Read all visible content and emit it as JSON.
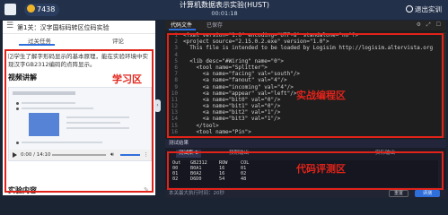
{
  "topbar": {
    "coin_count": "7438",
    "title": "计算机数据表示实验(HUST)",
    "timer": "00:01:18",
    "exit_label": "退出实训"
  },
  "left": {
    "level_title": "第1关：汉字国标码转区位码实验",
    "tabs": [
      "过关任务",
      "评论"
    ],
    "description": "⑵学生了解字形码显示的基本原理，能在实验环境中实现汉字GB2312编码的点阵显示。",
    "section_video": "视频讲解",
    "video_time": "0:00 / 14:10",
    "section_content": "实验内容",
    "label": "学习区"
  },
  "editor": {
    "tabs": [
      "代码文件",
      "已保存"
    ],
    "label": "实战编程区",
    "lines": [
      {
        "n": "1",
        "t": "<?xml version=\"1.0\" encoding=\"UTF-8\" standalone=\"no\"?>"
      },
      {
        "n": "2",
        "t": "<project source=\"2.15.0.2.exe\" version=\"1.0\">"
      },
      {
        "n": "3",
        "t": "  This file is intended to be loaded by Logisim http://logisim.altervista.org"
      },
      {
        "n": "4",
        "t": ""
      },
      {
        "n": "5",
        "t": "  <lib desc=\"#Wiring\" name=\"0\">"
      },
      {
        "n": "6",
        "t": "    <tool name=\"Splitter\">"
      },
      {
        "n": "7",
        "t": "      <a name=\"facing\" val=\"south\"/>"
      },
      {
        "n": "8",
        "t": "      <a name=\"fanout\" val=\"4\"/>"
      },
      {
        "n": "9",
        "t": "      <a name=\"incoming\" val=\"4\"/>"
      },
      {
        "n": "10",
        "t": "      <a name=\"appear\" val=\"left\"/>"
      },
      {
        "n": "11",
        "t": "      <a name=\"bit0\" val=\"0\"/>"
      },
      {
        "n": "12",
        "t": "      <a name=\"bit1\" val=\"0\"/>"
      },
      {
        "n": "13",
        "t": "      <a name=\"bit2\" val=\"1\"/>"
      },
      {
        "n": "14",
        "t": "      <a name=\"bit3\" val=\"1\"/>"
      },
      {
        "n": "15",
        "t": "    </tool>"
      },
      {
        "n": "16",
        "t": "    <tool name=\"Pin\">"
      }
    ]
  },
  "console": {
    "header": "测试结果",
    "tabs": [
      "测试集 1",
      "预期输出",
      "实际输出"
    ],
    "label": "代码评测区",
    "table_headers": [
      "Out",
      "GB2312",
      "ROW",
      "COL"
    ],
    "rows": [
      [
        "00",
        "B0A1",
        "16",
        "01"
      ],
      [
        "01",
        "B0A2",
        "16",
        "02"
      ],
      [
        "02",
        "D6D0",
        "54",
        "48"
      ]
    ]
  },
  "statusbar": {
    "left": "本关最大执行时间：20秒",
    "btn_reset": "重置",
    "btn_eval": "评测"
  }
}
